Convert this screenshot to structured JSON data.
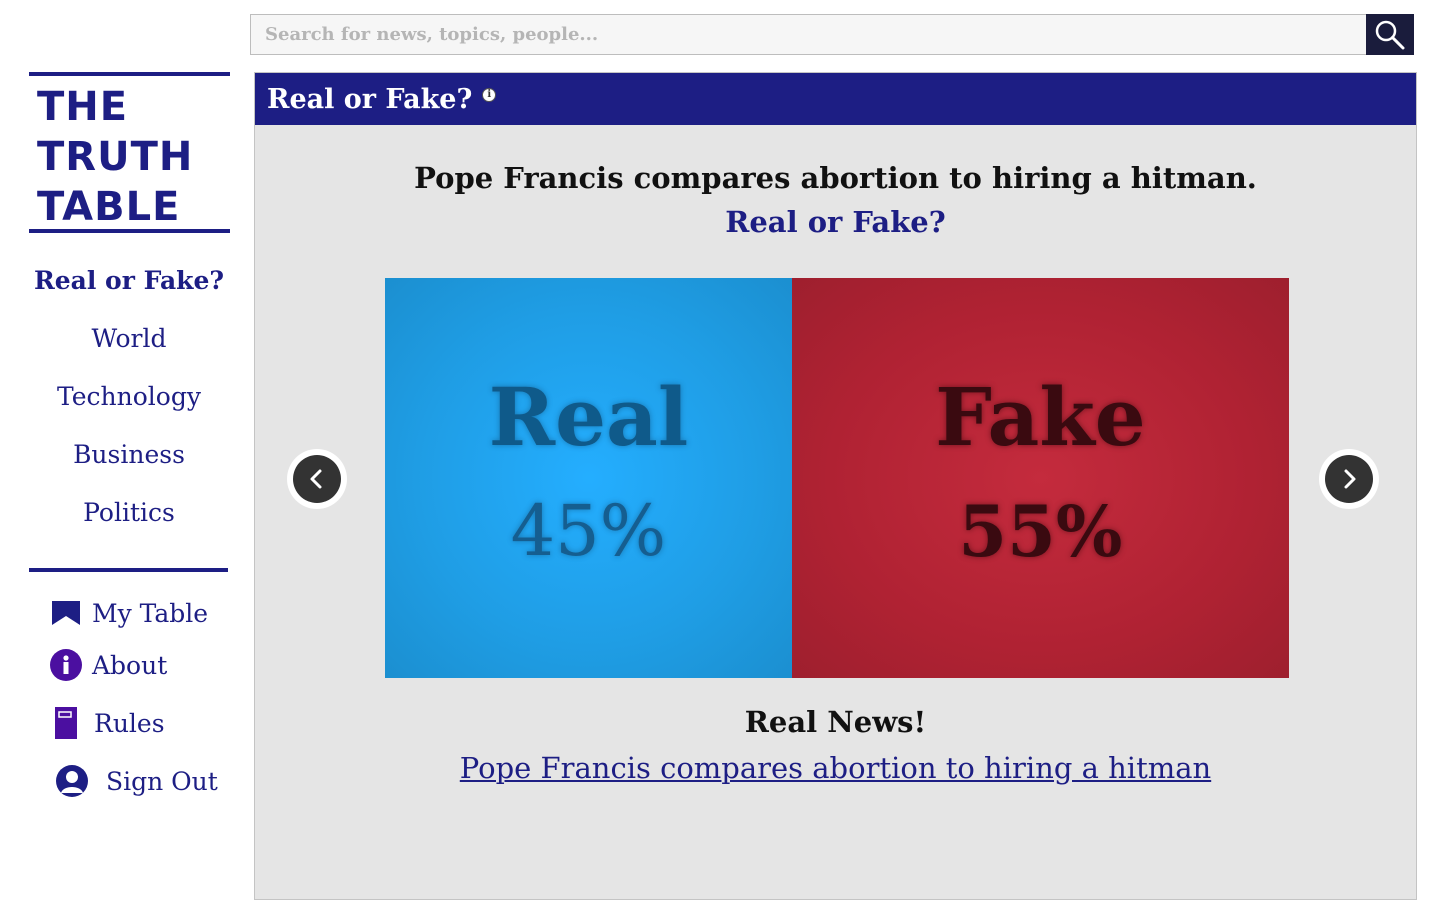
{
  "search": {
    "placeholder": "Search for news, topics, people..."
  },
  "logo": {
    "lines": [
      "THE",
      "TRUTH",
      "TABLE"
    ]
  },
  "nav": {
    "items": [
      {
        "label": "Real or Fake?",
        "active": true
      },
      {
        "label": "World"
      },
      {
        "label": "Technology"
      },
      {
        "label": "Business"
      },
      {
        "label": "Politics"
      }
    ]
  },
  "account": {
    "items": [
      {
        "label": "My Table",
        "icon": "bookmark-icon"
      },
      {
        "label": "About",
        "icon": "info-icon"
      },
      {
        "label": "Rules",
        "icon": "book-icon"
      },
      {
        "label": "Sign Out",
        "icon": "user-icon"
      }
    ]
  },
  "panel": {
    "title": "Real or Fake?",
    "info": "i",
    "headline": "Pope Francis compares abortion to hiring a hitman.",
    "question": "Real or Fake?",
    "real": {
      "label": "Real",
      "percent": "45%"
    },
    "fake": {
      "label": "Fake",
      "percent": "55%"
    },
    "result": "Real News!",
    "source_link": "Pope Francis compares abortion to hiring a hitman"
  },
  "vote_share": {
    "real": 45,
    "fake": 55
  },
  "colors": {
    "brand": "#1d1e84",
    "real": "#1f9de4",
    "fake": "#b02233",
    "panel_bg": "#e5e5e5"
  }
}
